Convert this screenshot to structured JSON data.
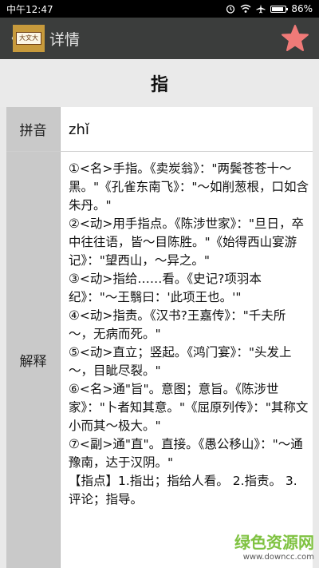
{
  "status_bar": {
    "carrier_time": "中午12:47",
    "battery": "86%",
    "battery_level": 0.86
  },
  "app_bar": {
    "back_glyph": "〈",
    "logo_text": "大文大",
    "title": "详情",
    "favorite_icon": "star-icon",
    "favorite_color": "#f07a78"
  },
  "character": "指",
  "pinyin": {
    "label": "拼音",
    "value": "zhǐ"
  },
  "definition": {
    "label": "解释",
    "text": "①<名>手指。《卖炭翁》：\"两鬓苍苍十～黑。\"《孔雀东南飞》：\"～如削葱根，口如含朱丹。\"\n②<动>用手指点。《陈涉世家》：\"旦日，卒中往往语，皆～目陈胜。\"《始得西山宴游记》：\"望西山，～异之。\"\n③<动>指给……看。《史记?项羽本纪》：\"～王翳曰：'此项王也。'\"\n④<动>指责。《汉书?王嘉传》：\"千夫所～，无病而死。\"\n⑤<动>直立；竖起。《鸿门宴》：\"头发上～，目眦尽裂。\"\n⑥<名>通\"旨\"。意图；意旨。《陈涉世家》：\"卜者知其意。\"《屈原列传》：\"其称文小而其～极大。\"\n⑦<副>通\"直\"。直接。《愚公移山》：\"～通豫南，达于汉阴。\"\n【指点】1.指出；指给人看。 2.指责。 3.评论；指导。"
  },
  "watermark": {
    "title": "绿色资源网",
    "url": "www.downcc.com"
  }
}
